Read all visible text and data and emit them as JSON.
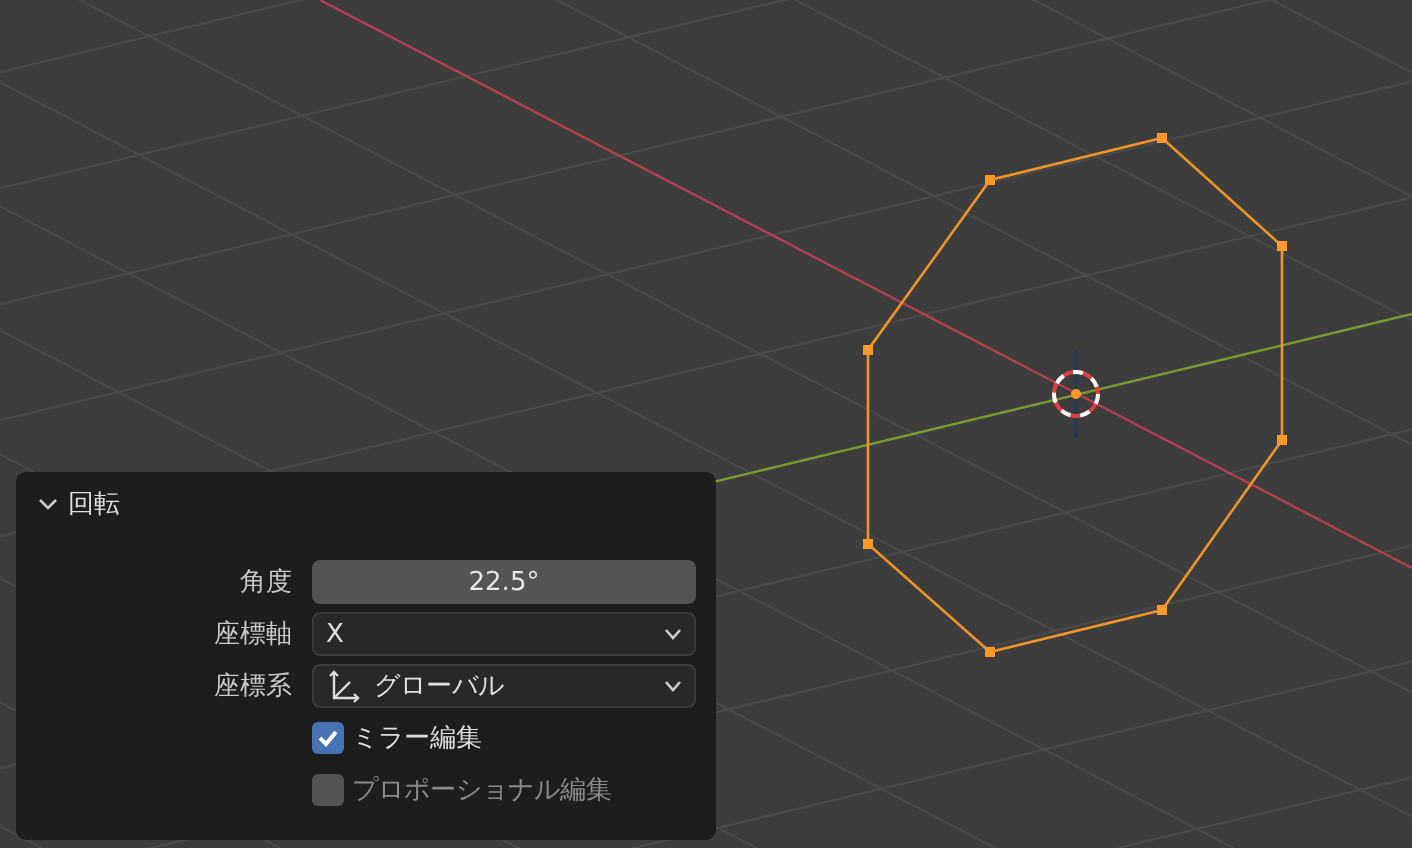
{
  "panel": {
    "title": "回転",
    "expanded": true,
    "fields": [
      {
        "kind": "number",
        "label": "角度",
        "value": "22.5°"
      },
      {
        "kind": "dropdown",
        "label": "座標軸",
        "value": "X"
      },
      {
        "kind": "dropdown_icon",
        "label": "座標系",
        "value": "グローバル"
      }
    ],
    "checkboxes": [
      {
        "label": "ミラー編集",
        "checked": true,
        "disabled": false
      },
      {
        "label": "プロポーショナル編集",
        "checked": false,
        "disabled": true
      }
    ]
  }
}
